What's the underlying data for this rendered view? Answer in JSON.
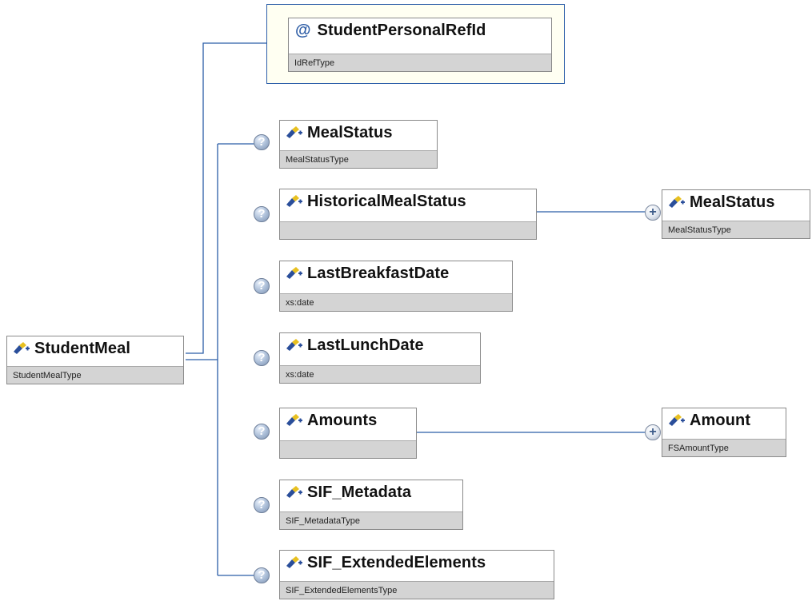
{
  "colors": {
    "connector": "#2b5ea8",
    "type_bar": "#d4d4d4",
    "attribute_group_bg": "#fffff2"
  },
  "root": {
    "name": "StudentMeal",
    "type": "StudentMealType",
    "icon": "element-icon"
  },
  "attribute": {
    "name": "StudentPersonalRefId",
    "type": "IdRefType",
    "icon": "at-sign-icon"
  },
  "optional_badge": "?",
  "expand_glyph": "+",
  "children": [
    {
      "name": "MealStatus",
      "type": "MealStatusType",
      "optional": true
    },
    {
      "name": "HistoricalMealStatus",
      "type": "",
      "optional": true,
      "child": {
        "name": "MealStatus",
        "type": "MealStatusType"
      }
    },
    {
      "name": "LastBreakfastDate",
      "type": "xs:date",
      "optional": true
    },
    {
      "name": "LastLunchDate",
      "type": "xs:date",
      "optional": true
    },
    {
      "name": "Amounts",
      "type": "",
      "optional": true,
      "child": {
        "name": "Amount",
        "type": "FSAmountType"
      }
    },
    {
      "name": "SIF_Metadata",
      "type": "SIF_MetadataType",
      "optional": true
    },
    {
      "name": "SIF_ExtendedElements",
      "type": "SIF_ExtendedElementsType",
      "optional": true
    }
  ]
}
